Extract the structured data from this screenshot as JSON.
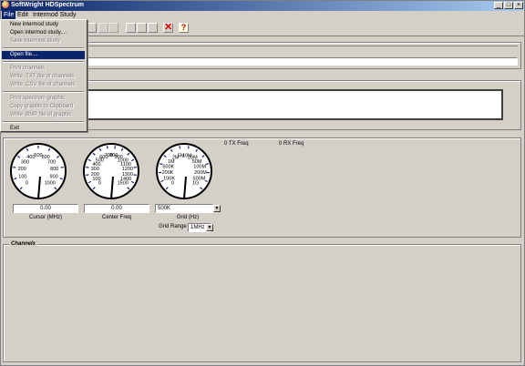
{
  "window": {
    "title": "SoftWright HDSpectrum"
  },
  "menu": {
    "file": "File",
    "edit": "Edit",
    "intermod": "Intermod Study"
  },
  "file_menu": [
    {
      "label": "New intermod study",
      "enabled": true
    },
    {
      "label": "Open intermod study....",
      "enabled": true
    },
    {
      "label": "Save intermod study",
      "enabled": false
    },
    {
      "sep": true
    },
    {
      "label": "Open file....",
      "enabled": true,
      "selected": true
    },
    {
      "sep": true
    },
    {
      "label": "Print channels",
      "enabled": false
    },
    {
      "label": "Write .TXT file of channels",
      "enabled": false
    },
    {
      "label": "Write .CSV file of channels",
      "enabled": false
    },
    {
      "sep": true
    },
    {
      "label": "Print spectrum graphic",
      "enabled": false
    },
    {
      "label": "Copy graphic to Clipboard",
      "enabled": false
    },
    {
      "label": "Write .BMP file of graphic",
      "enabled": false
    },
    {
      "sep": true
    },
    {
      "label": "Exit",
      "enabled": true
    }
  ],
  "gauges": {
    "cursor": {
      "labels": [
        "0",
        "100",
        "200",
        "300",
        "400",
        "500",
        "600",
        "700",
        "800",
        "900",
        "1000"
      ],
      "value": "0.00",
      "caption": "Cursor (MHz)"
    },
    "center": {
      "labels": [
        "0",
        "100",
        "200",
        "300",
        "400",
        "500",
        "600",
        "700",
        "800",
        "900",
        "1000",
        "1100",
        "1200",
        "1300",
        "1400",
        "1500"
      ],
      "value": "0.00",
      "caption": "Center Freq"
    },
    "grid": {
      "labels": [
        "0",
        "100K",
        "200K",
        "500K",
        "1M",
        "2M",
        "5M",
        "10M",
        "20M",
        "50M",
        "100M",
        "200M",
        "500M",
        "1G"
      ],
      "value": "500K",
      "caption": "Grid (Hz)"
    }
  },
  "tx_freq": "0 TX Freq",
  "rx_freq": "0 RX Freq",
  "grid_range": {
    "label": "Grid Range",
    "value": "1MHz"
  },
  "channels": {
    "title": "Channels"
  }
}
